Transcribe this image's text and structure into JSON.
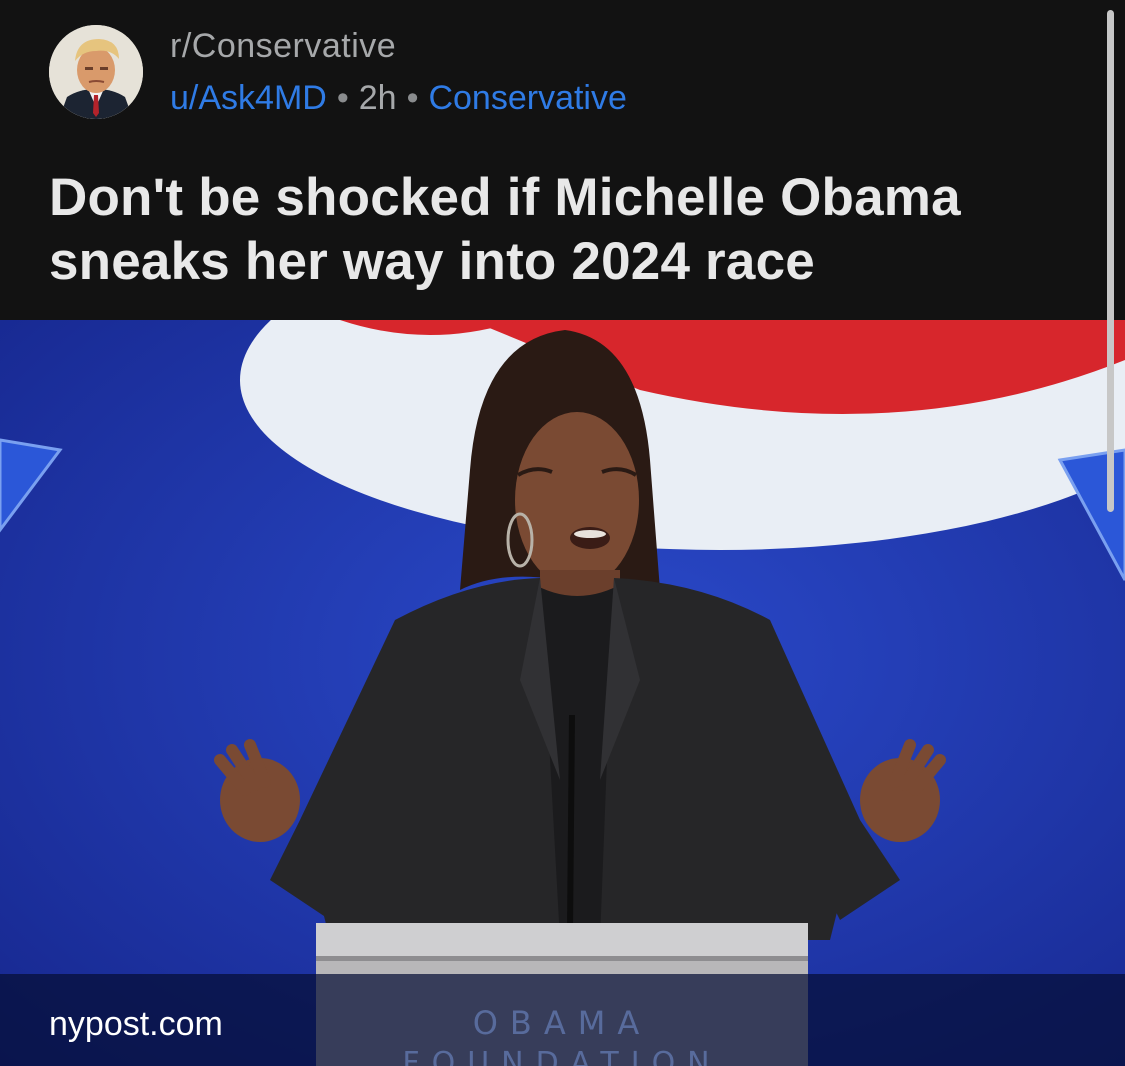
{
  "post": {
    "subreddit": "r/Conservative",
    "author": "u/Ask4MD",
    "separator": "•",
    "age": "2h",
    "flair": "Conservative",
    "title": "Don't be shocked if Michelle Obama sneaks her way into 2024 race"
  },
  "link": {
    "domain": "nypost.com"
  },
  "image": {
    "podium_line1": "OBAMA",
    "podium_line2": "FOUNDATION"
  },
  "colors": {
    "background": "#121212",
    "link_blue": "#2f7be5",
    "meta_gray": "#a6a8aa",
    "title_text": "#e8e8e8"
  },
  "icons": {
    "avatar": "subreddit-avatar-portrait"
  }
}
